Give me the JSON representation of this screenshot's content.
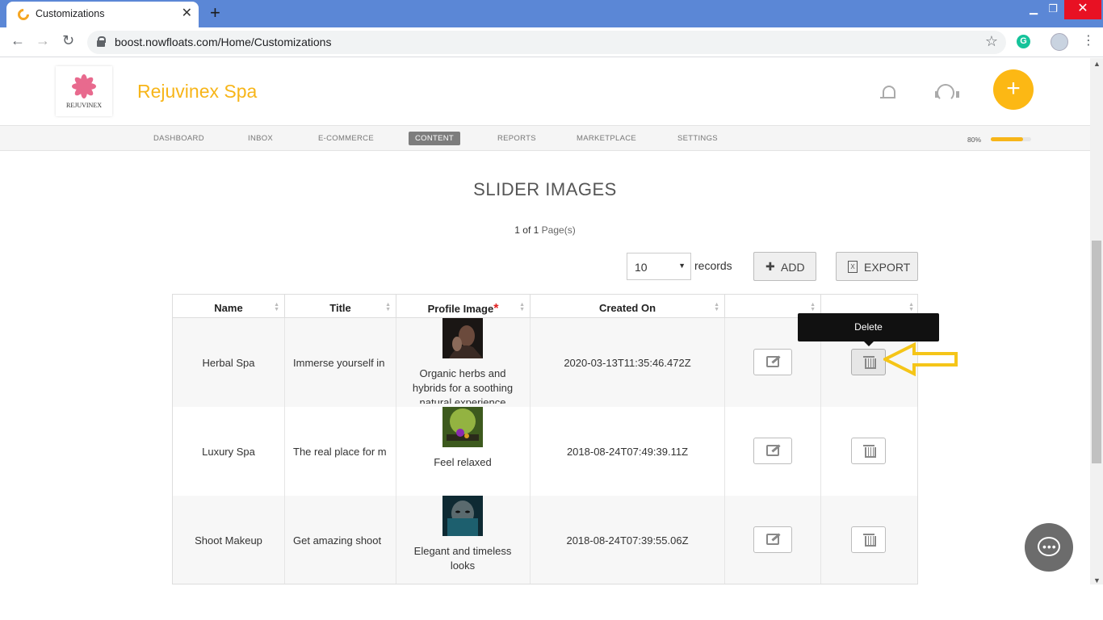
{
  "browser": {
    "tab_title": "Customizations",
    "tab_close": "✕",
    "new_tab": "+",
    "url": "boost.nowfloats.com/Home/Customizations",
    "extension_label": "G"
  },
  "header": {
    "logo_text": "REJUVINEX",
    "brand": "Rejuvinex Spa",
    "fab_label": "+"
  },
  "nav": {
    "items": [
      "DASHBOARD",
      "INBOX",
      "E-COMMERCE",
      "CONTENT",
      "REPORTS",
      "MARKETPLACE",
      "SETTINGS"
    ],
    "active": "CONTENT",
    "progress_label": "80%",
    "progress_value": 0.8
  },
  "main": {
    "title": "SLIDER IMAGES",
    "page_info_prefix": "1 of 1",
    "page_info_suffix": "Page(s)",
    "page_size": "10",
    "records_label": "records",
    "add_label": "ADD",
    "export_label": "EXPORT",
    "tooltip": "Delete"
  },
  "table": {
    "headers": [
      "Name",
      "Title",
      "Profile Image",
      "Created On",
      "",
      ""
    ],
    "required_mark": "*",
    "rows": [
      {
        "name": "Herbal Spa",
        "title": "Immerse yourself in",
        "caption": "Organic herbs and hybrids for a soothing natural experience",
        "created_on": "2020-03-13T11:35:46.472Z"
      },
      {
        "name": "Luxury Spa",
        "title": "The real place for m",
        "caption": "Feel relaxed",
        "created_on": "2018-08-24T07:49:39.11Z"
      },
      {
        "name": "Shoot Makeup",
        "title": "Get amazing shoot",
        "caption": "Elegant and timeless looks",
        "created_on": "2018-08-24T07:39:55.06Z"
      }
    ]
  },
  "colors": {
    "brand": "#f7b519",
    "chrome_titlebar": "#5b87d6",
    "annotation_arrow": "#f5c518"
  }
}
